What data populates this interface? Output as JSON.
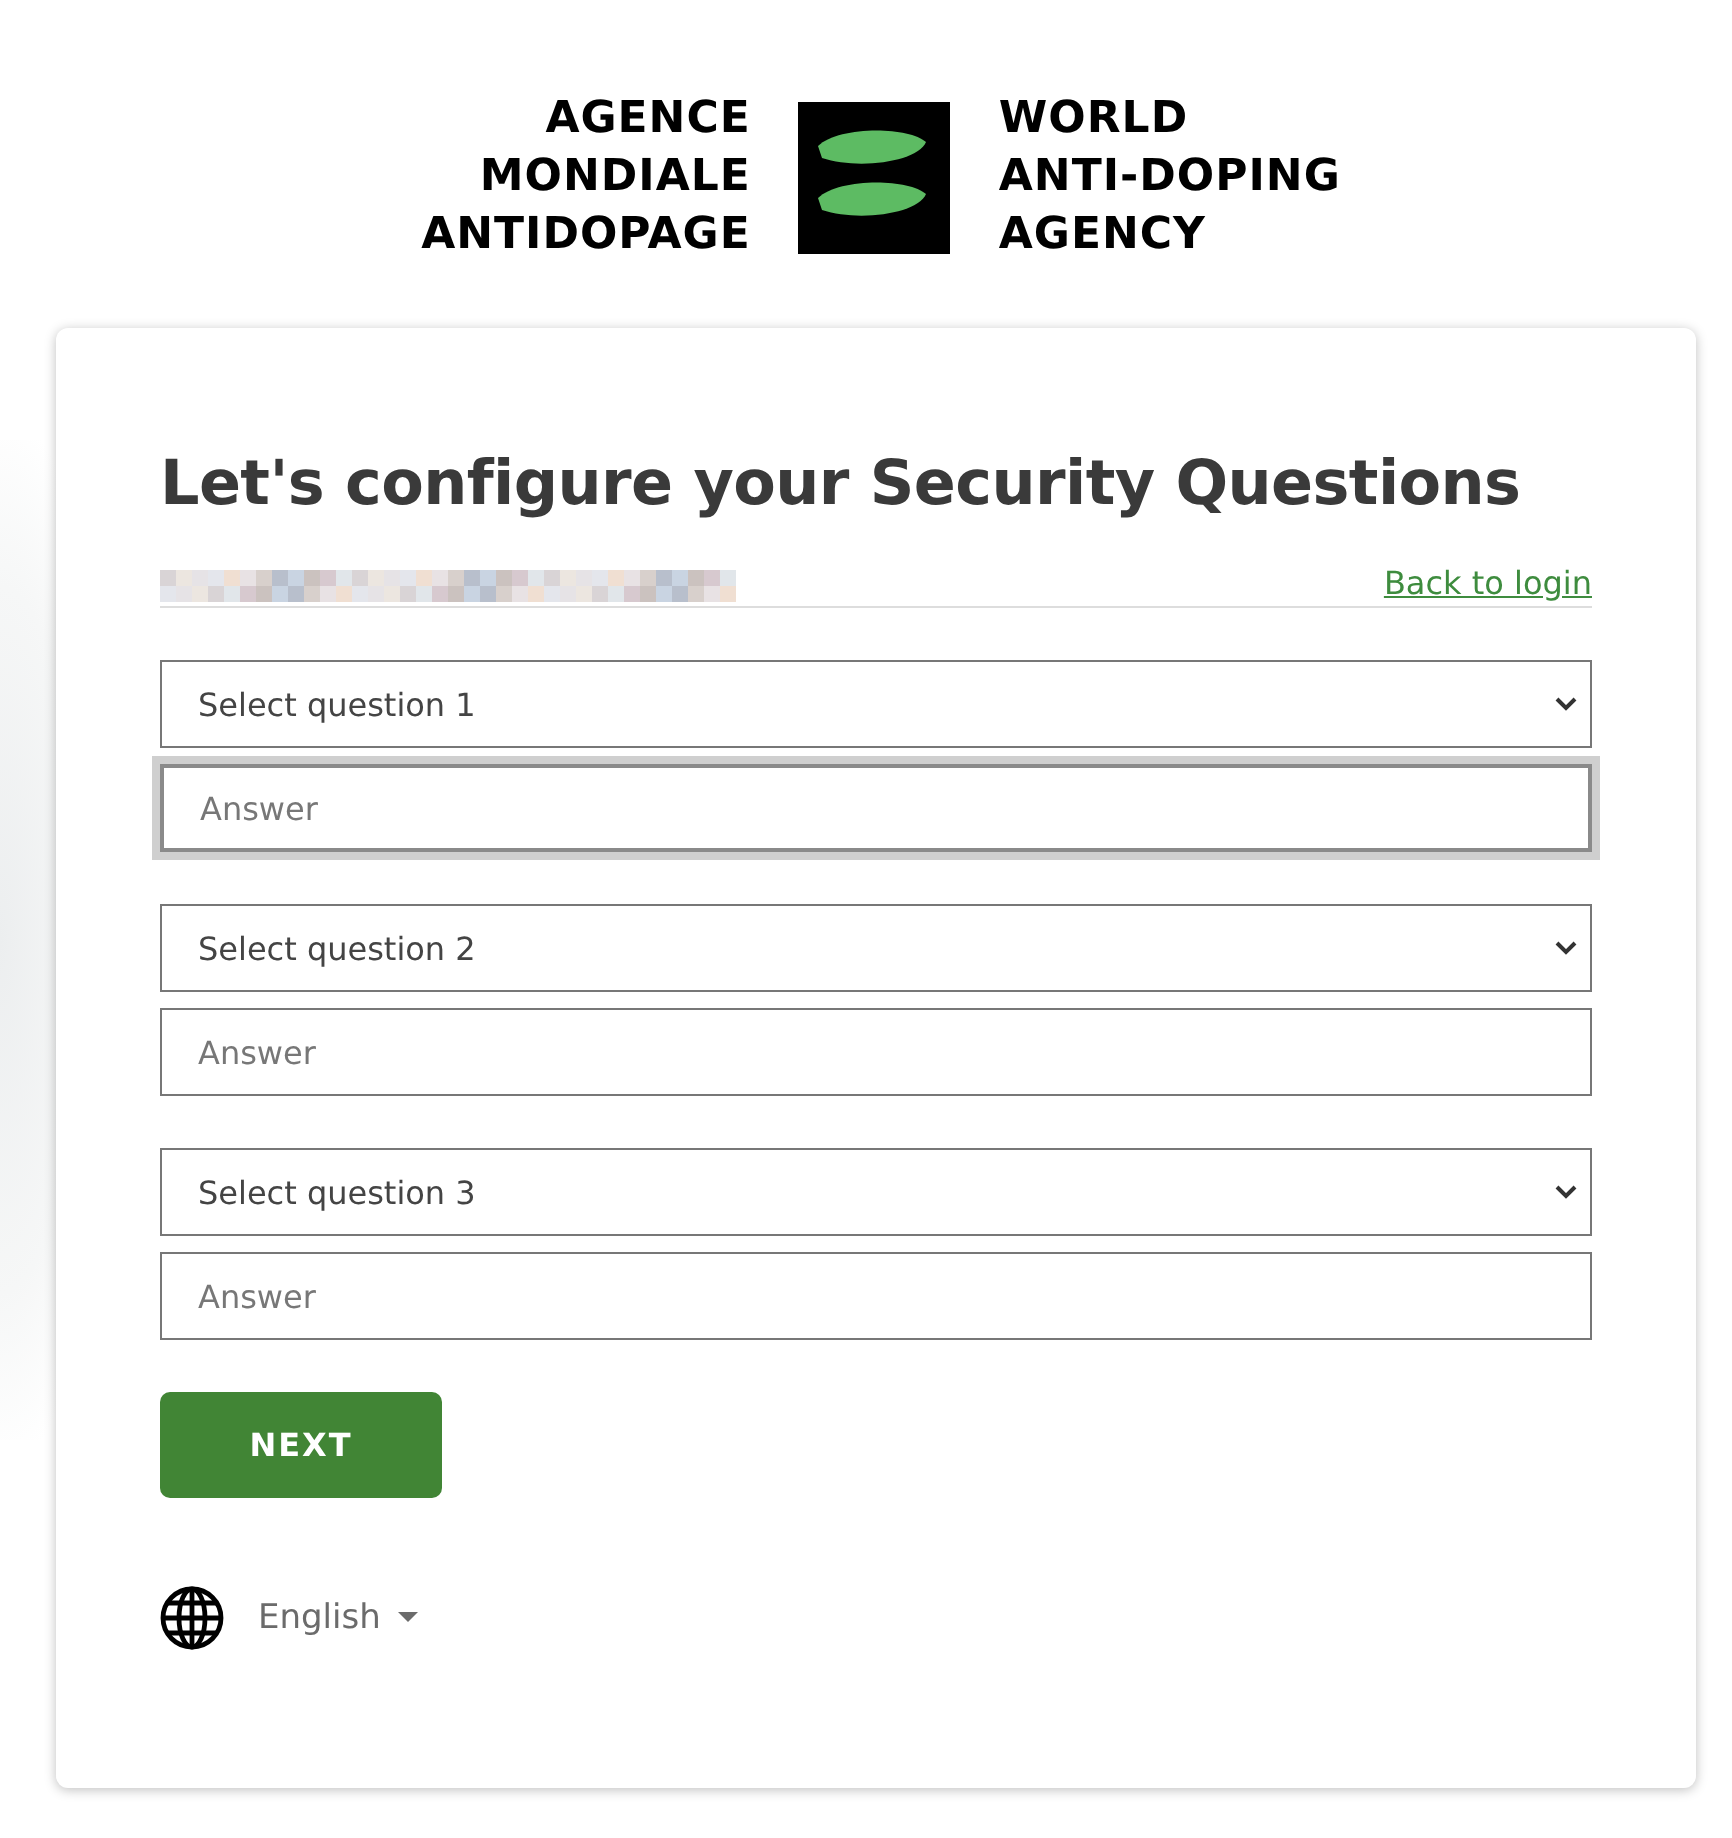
{
  "logo": {
    "left_lines": [
      "AGENCE",
      "MONDIALE",
      "ANTIDOPAGE"
    ],
    "right_lines": [
      "WORLD",
      "ANTI-DOPING",
      "AGENCY"
    ]
  },
  "title": "Let's configure your Security Questions",
  "back_link": "Back to login",
  "questions": [
    {
      "select": "Select question 1",
      "answer_placeholder": "Answer",
      "focused": true
    },
    {
      "select": "Select question 2",
      "answer_placeholder": "Answer",
      "focused": false
    },
    {
      "select": "Select question 3",
      "answer_placeholder": "Answer",
      "focused": false
    }
  ],
  "next_button": "NEXT",
  "language": "English"
}
